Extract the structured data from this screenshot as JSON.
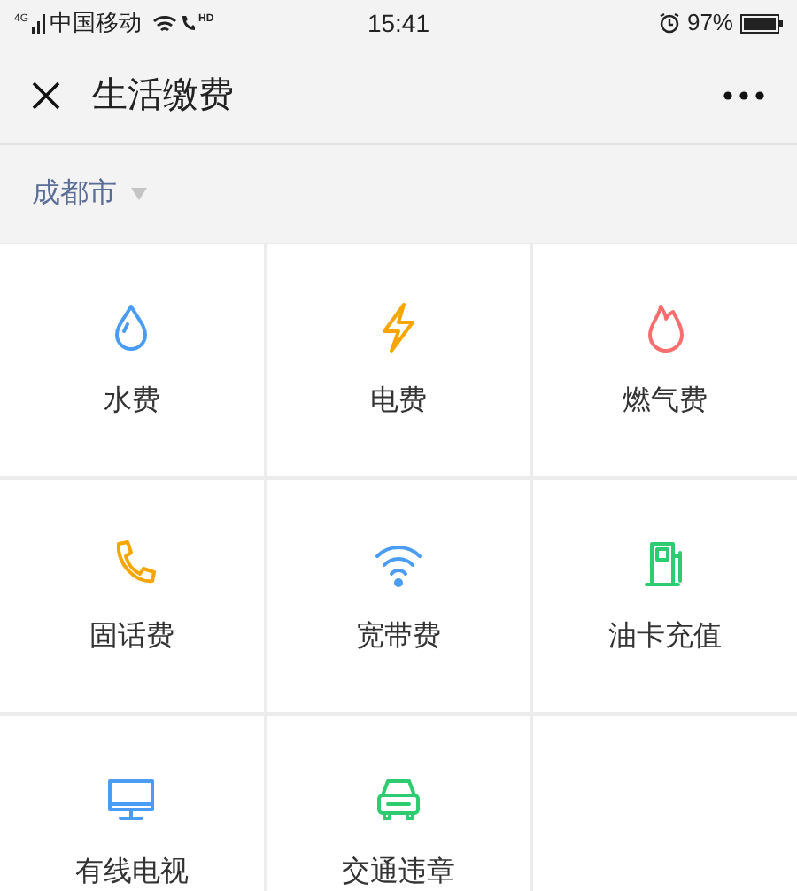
{
  "status_bar": {
    "network": "4G",
    "carrier": "中国移动",
    "call_badge": "HD",
    "time": "15:41",
    "battery": "97%"
  },
  "header": {
    "title": "生活缴费"
  },
  "city": {
    "label": "成都市"
  },
  "services": [
    {
      "label": "水费",
      "kind": "water",
      "color": "#4a9cf5"
    },
    {
      "label": "电费",
      "kind": "bolt",
      "color": "#f7a500"
    },
    {
      "label": "燃气费",
      "kind": "flame",
      "color": "#f76e6e"
    },
    {
      "label": "固话费",
      "kind": "phone",
      "color": "#f7a500"
    },
    {
      "label": "宽带费",
      "kind": "wifi",
      "color": "#4a9cf5"
    },
    {
      "label": "油卡充值",
      "kind": "fuel",
      "color": "#2ecc71"
    },
    {
      "label": "有线电视",
      "kind": "tv",
      "color": "#4a9cf5"
    },
    {
      "label": "交通违章",
      "kind": "car",
      "color": "#2ecc71"
    }
  ]
}
